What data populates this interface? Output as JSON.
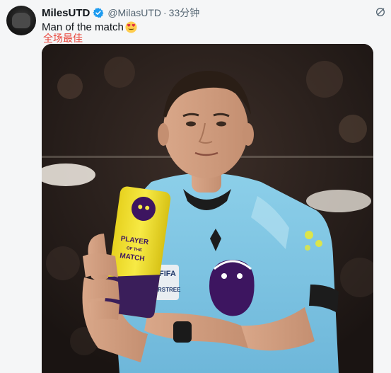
{
  "post": {
    "display_name": "MilesUTD",
    "handle": "@MilasUTD",
    "separator": "·",
    "time": "33分钟",
    "text": "Man of the match",
    "translation": "全场最佳"
  },
  "photo": {
    "trophy_text_line1": "PLAYER",
    "trophy_text_line2": "OF THE",
    "trophy_text_line3": "MATCH",
    "badge_text": "FIFA",
    "badge_subtext": "RSTREE"
  },
  "colors": {
    "verified": "#1d9bf0",
    "translation": "#e8443a",
    "shirt": "#7fc4e4",
    "trophy": "#f2e02c",
    "trophy_base": "#3a1e5a",
    "lion": "#3d1560"
  }
}
